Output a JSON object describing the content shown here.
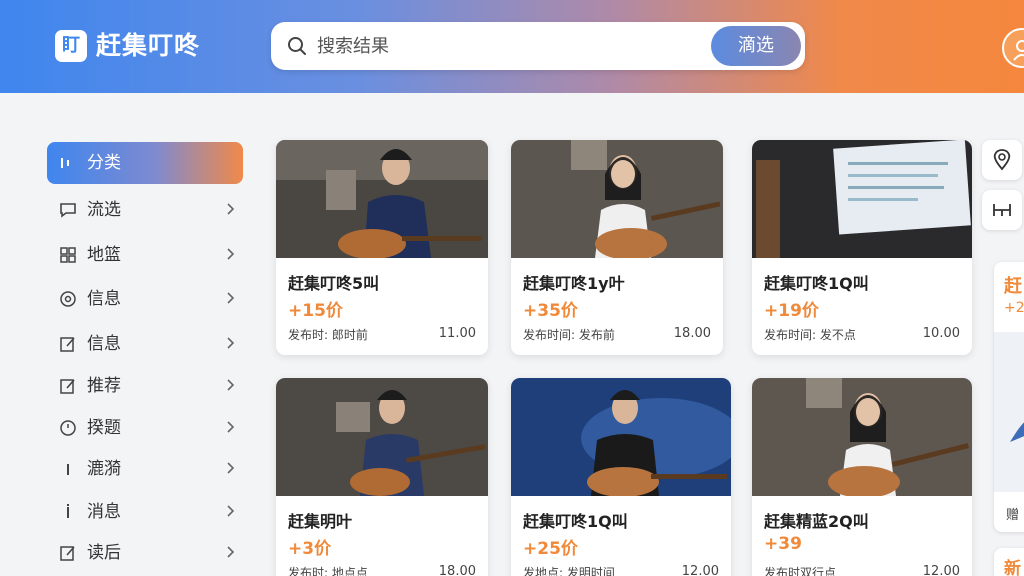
{
  "header": {
    "logo_glyph": "盯",
    "app_title": "赶集叮咚",
    "search": {
      "placeholder": "搜索结果",
      "value": ""
    },
    "filter_label": "滴选"
  },
  "sidebar": {
    "items": [
      {
        "label": "分类",
        "icon": "grid-icon",
        "active": true
      },
      {
        "label": "流选",
        "icon": "chat-icon"
      },
      {
        "label": "地篮",
        "icon": "apps-icon"
      },
      {
        "label": "信息",
        "icon": "search-circle-icon"
      },
      {
        "label": "信息",
        "icon": "edit-icon"
      },
      {
        "label": "推荐",
        "icon": "edit-icon"
      },
      {
        "label": "揆题",
        "icon": "clock-icon"
      },
      {
        "label": "漉漪",
        "icon": "bar-icon"
      },
      {
        "label": "消息",
        "icon": "bar-icon"
      },
      {
        "label": "读后",
        "icon": "edit-icon"
      }
    ]
  },
  "cards": [
    {
      "title": "赶集叮咚5叫",
      "price": "+15价",
      "meta": "发布时: 郎时前",
      "num": "11.00"
    },
    {
      "title": "赶集叮咚1y叶",
      "price": "+35价",
      "meta": "发布时间: 发布前",
      "num": "18.00"
    },
    {
      "title": "赶集叮咚1Q叫",
      "price": "+19价",
      "meta": "发布时间: 发不点",
      "num": "10.00"
    },
    {
      "title": "赶集明叶",
      "price": "+3价",
      "meta": "发布时: 地点点",
      "num": "18.00"
    },
    {
      "title": "赶集叮咚1Q叫",
      "price": "+25价",
      "meta": "发地点: 发明时间",
      "num": "12.00"
    },
    {
      "title": "赶集精蓝2Q叫",
      "price": "+39",
      "meta": "发布时双行点",
      "num": "12.00"
    }
  ],
  "rail": {
    "card1_title": "赶",
    "card1_price": "+2",
    "card2_label": "赠",
    "card3_label": "新"
  },
  "colors": {
    "blue": "#3f86ee",
    "orange": "#f5873d",
    "price": "#f08a3a"
  }
}
